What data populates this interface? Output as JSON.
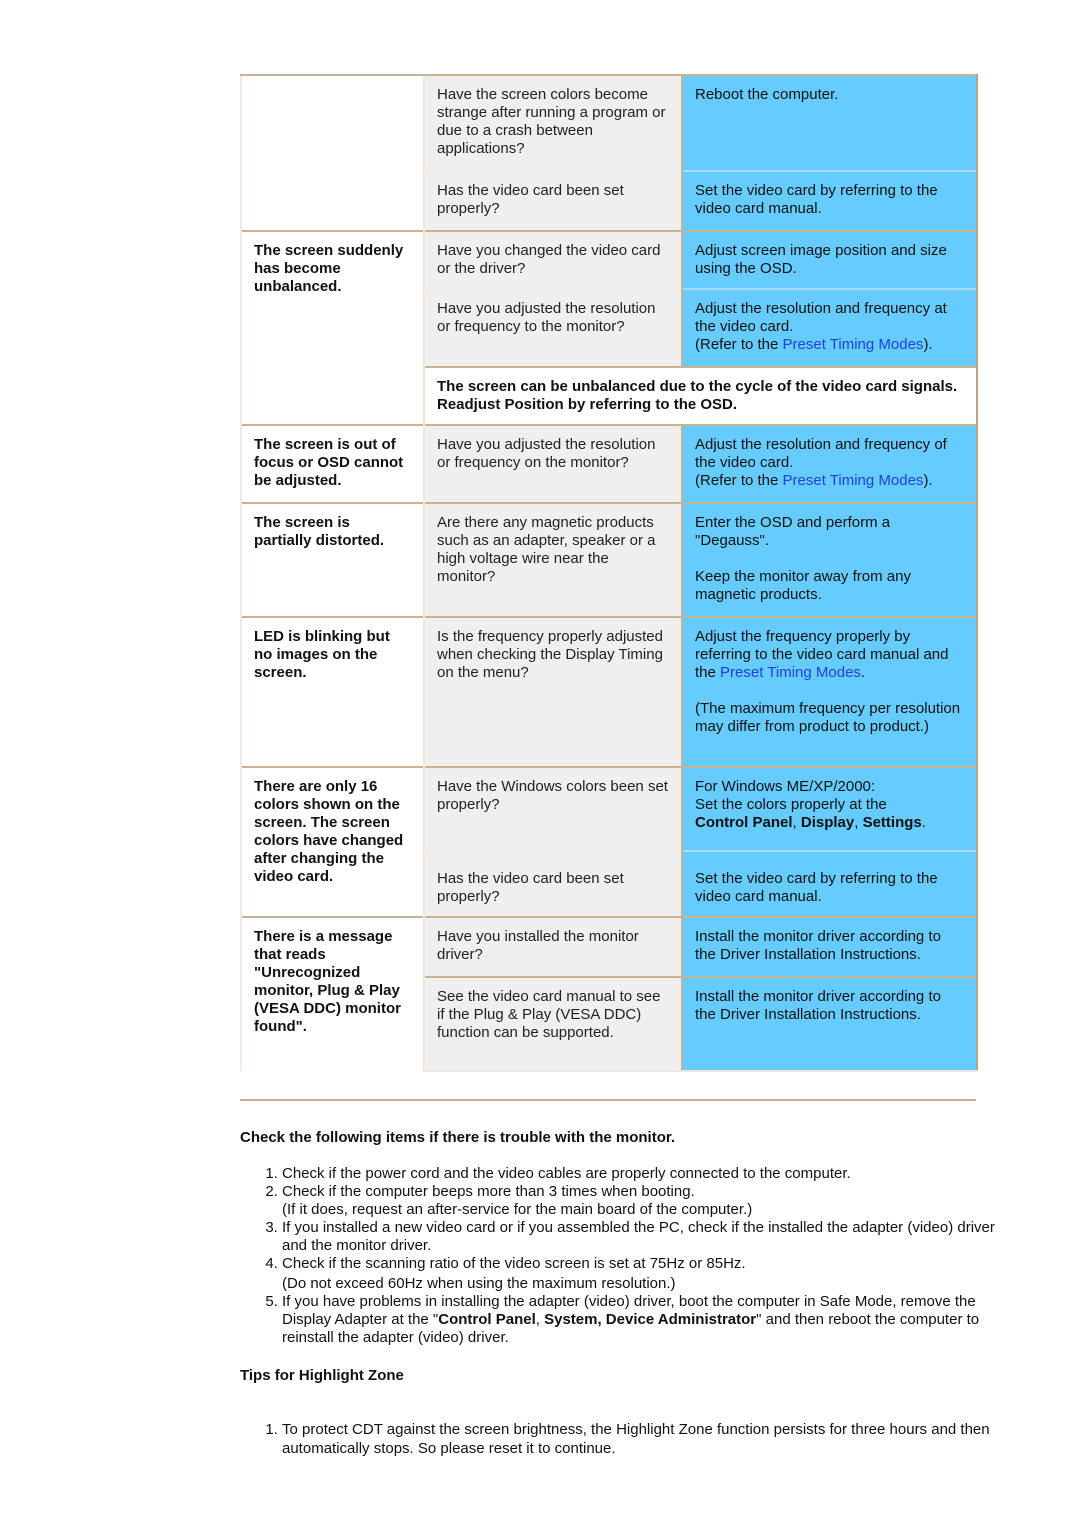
{
  "table": {
    "link_text": "Preset Timing Modes",
    "groups": [
      {
        "symptom": "",
        "rows": [
          {
            "question": "Have the screen colors become strange after running a program or due to a crash between applications?",
            "answer": "Reboot the computer."
          },
          {
            "question": "Has the video card been set properly?",
            "answer": "Set the video card by referring to the video card manual."
          }
        ]
      },
      {
        "symptom": "The screen suddenly has become unbalanced.",
        "rows": [
          {
            "question": "Have you changed the video card or the driver?",
            "answer": "Adjust screen image position and size using the OSD."
          },
          {
            "question": "Have you adjusted the resolution or frequency to the monitor?",
            "answer_l1": "Adjust the resolution and frequency at the video card.",
            "answer_pre": "(Refer to the ",
            "answer_post": ")."
          }
        ],
        "note": "The screen can be unbalanced due to the cycle of the video card signals. Readjust Position by referring to the OSD."
      },
      {
        "symptom": "The screen is out of focus or OSD cannot be adjusted.",
        "rows": [
          {
            "question": "Have you adjusted the resolution or frequency on the monitor?",
            "answer_l1": "Adjust the resolution and frequency of the video card.",
            "answer_pre": "(Refer to the ",
            "answer_post": ")."
          }
        ]
      },
      {
        "symptom": "The screen is partially distorted.",
        "rows": [
          {
            "question": "Are there any magnetic products such as an adapter, speaker or a high voltage wire near the monitor?",
            "answer_p1": "Enter the OSD and perform a \"Degauss\".",
            "answer_p2": "Keep the monitor away from any magnetic products."
          }
        ]
      },
      {
        "symptom": "LED is blinking but no images on the screen.",
        "rows": [
          {
            "question": "Is the frequency properly adjusted when checking the Display Timing on the menu?",
            "answer_pre": "Adjust the frequency properly by referring to the video card manual and the ",
            "answer_post": ".",
            "answer_p2": "(The maximum frequency per resolution may differ from product to product.)"
          }
        ]
      },
      {
        "symptom": "There are only 16 colors shown on the screen. The screen colors have changed after changing the video card.",
        "rows": [
          {
            "question": "Have the Windows colors been set properly?",
            "answer_l1": "For Windows ME/XP/2000:",
            "answer_l2": "Set the colors properly at the",
            "answer_b1": "Control Panel",
            "answer_b2": "Display",
            "answer_b3": "Settings",
            "sep": ", ",
            "end": "."
          },
          {
            "question": "Has the video card been set properly?",
            "answer": "Set the video card by referring to the video card manual."
          }
        ]
      },
      {
        "symptom": "There is a message that reads \"Unrecognized monitor, Plug & Play (VESA DDC) monitor found\".",
        "rows": [
          {
            "question": "Have you installed the monitor driver?",
            "answer": "Install the monitor driver according to the Driver Installation Instructions."
          },
          {
            "question": "See the video card manual to see if the Plug & Play (VESA DDC) function can be supported.",
            "answer": "Install the monitor driver according to the Driver Installation Instructions."
          }
        ]
      }
    ]
  },
  "check": {
    "heading": "Check the following items if there is trouble with the monitor.",
    "items": [
      {
        "text": "Check if the power cord and the video cables are properly connected to the computer."
      },
      {
        "text": "Check if the computer beeps more than 3 times when booting.",
        "sub": "(If it does, request an after-service for the main board of the computer.)"
      },
      {
        "text": "If you installed a new video card or if you assembled the PC, check if the installed the adapter (video) driver and the monitor driver."
      },
      {
        "text": "Check if the scanning ratio of the video screen is set at 75Hz or 85Hz.",
        "sub": "(Do not exceed 60Hz when using the maximum resolution.)"
      },
      {
        "pre": "If you have problems in installing the adapter (video) driver, boot the computer in Safe Mode, remove the Display Adapter at the \"",
        "b1": "Control Panel",
        "b2": "System, Device Administrator",
        "post": "\" and then reboot the computer to reinstall the adapter (video) driver."
      }
    ]
  },
  "tips": {
    "heading": "Tips for Highlight Zone",
    "items": [
      {
        "text": "To protect CDT against the screen brightness, the Highlight Zone function persists for three hours and then automatically stops. So please reset it to continue."
      }
    ]
  },
  "colors": {
    "answer_bg": "#66ccff",
    "question_bg": "#efefef",
    "link": "#1f3fe0",
    "divider": "#c8b28a"
  }
}
